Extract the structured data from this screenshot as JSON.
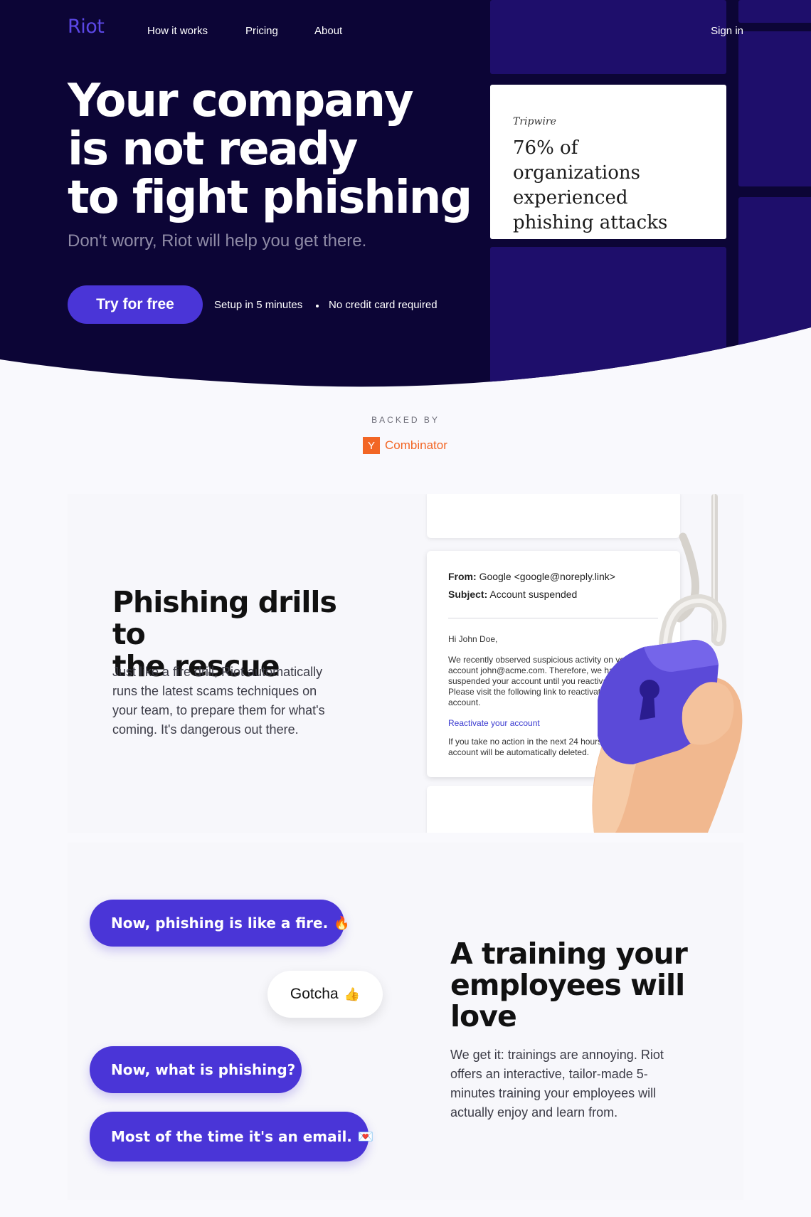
{
  "nav": {
    "logo": "Riot",
    "links": [
      "How it works",
      "Pricing",
      "About"
    ],
    "sign_in": "Sign in"
  },
  "hero": {
    "title_lines": [
      "Your company",
      "is not ready",
      "to fight phishing"
    ],
    "subtitle": "Don't worry, Riot will help you get there.",
    "cta": "Try for free",
    "notes": [
      "Setup in 5 minutes",
      "No credit card required"
    ],
    "stat_card": {
      "brand": "Tripwire",
      "text": "76% of organizations experienced phishing attacks"
    }
  },
  "backed": {
    "label": "BACKED BY",
    "yc_letter": "Y",
    "yc_name": "Combinator"
  },
  "drills": {
    "title_lines": [
      "Phishing drills to",
      "the rescue"
    ],
    "body_lines": [
      "Just like a fire drill, Riot automatically",
      "runs the latest scams techniques on",
      "your team, to prepare them for what's",
      "coming. It's dangerous out there."
    ],
    "email": {
      "from_label": "From:",
      "from_value": "Google <google@noreply.link>",
      "subject_label": "Subject:",
      "subject_value": "Account suspended",
      "greeting": "Hi John Doe,",
      "body_lines": [
        "We recently observed suspicious activity on your",
        "account john@acme.com. Therefore, we have",
        "suspended your account until you reactivate it.",
        "Please visit the following link to reactivate your",
        "account."
      ],
      "link": "Reactivate your account",
      "footer_lines": [
        "If you take no action in the next 24 hours, your",
        "account will be automatically deleted."
      ]
    }
  },
  "training": {
    "bubbles": [
      "Now, phishing is like a fire.",
      "Gotcha",
      "Now, what is phishing?",
      "Most of the time it's an email."
    ],
    "emojis": [
      "fire-emoji",
      "thumbs-up-emoji",
      "envelope-emoji"
    ],
    "emoji_glyphs": [
      "🔥",
      "👍",
      "💌"
    ],
    "title_lines": [
      "A training your",
      "employees will",
      "love"
    ],
    "body_lines": [
      "We get it: trainings are annoying. Riot",
      "offers an interactive, tailor-made 5-",
      "minutes training your employees will",
      "actually enjoy and learn from."
    ]
  },
  "colors": {
    "hero_bg": "#0c0536",
    "tile": "#1e0e6b",
    "accent": "#4a35d7",
    "yc_orange": "#f26625"
  }
}
